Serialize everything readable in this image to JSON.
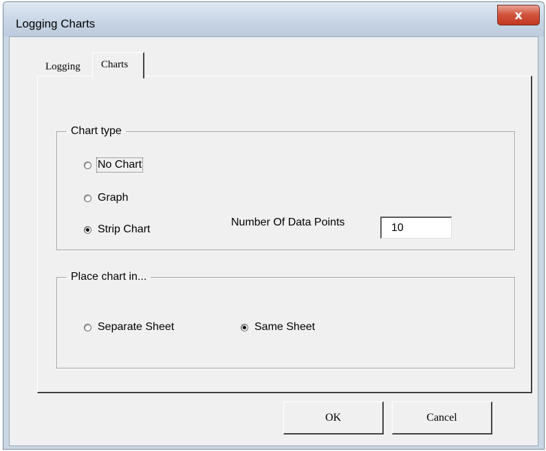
{
  "window": {
    "title": "Logging Charts",
    "close_symbol": "x",
    "close_icon": "close-icon"
  },
  "tabs": [
    {
      "label": "Logging",
      "selected": false
    },
    {
      "label": "Charts",
      "selected": true
    }
  ],
  "chart_type": {
    "legend": "Chart type",
    "options": [
      {
        "label": "No Chart",
        "selected": false,
        "focused": true
      },
      {
        "label": "Graph",
        "selected": false
      },
      {
        "label": "Strip Chart",
        "selected": true
      }
    ],
    "data_points_label": "Number Of Data Points",
    "data_points_value": "10"
  },
  "place_chart": {
    "legend": "Place chart in...",
    "options": [
      {
        "label": "Separate Sheet",
        "selected": false
      },
      {
        "label": "Same Sheet",
        "selected": true
      }
    ]
  },
  "buttons": {
    "ok": "OK",
    "cancel": "Cancel"
  }
}
